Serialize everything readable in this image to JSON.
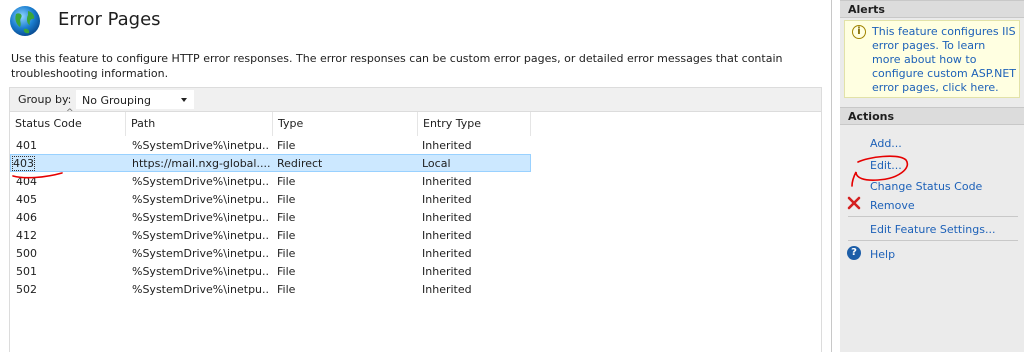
{
  "header": {
    "title": "Error Pages",
    "description": "Use this feature to configure HTTP error responses. The error responses can be custom error pages, or detailed error messages that contain troubleshooting information."
  },
  "toolbar": {
    "group_by_label": "Group by:",
    "group_by_value": "No Grouping"
  },
  "grid": {
    "columns": [
      "Status Code",
      "Path",
      "Type",
      "Entry Type"
    ],
    "rows": [
      {
        "code": "401",
        "path": "%SystemDrive%\\inetpu...",
        "type": "File",
        "entry": "Inherited"
      },
      {
        "code": "403",
        "path": "https://mail.nxg-global....",
        "type": "Redirect",
        "entry": "Local"
      },
      {
        "code": "404",
        "path": "%SystemDrive%\\inetpu...",
        "type": "File",
        "entry": "Inherited"
      },
      {
        "code": "405",
        "path": "%SystemDrive%\\inetpu...",
        "type": "File",
        "entry": "Inherited"
      },
      {
        "code": "406",
        "path": "%SystemDrive%\\inetpu...",
        "type": "File",
        "entry": "Inherited"
      },
      {
        "code": "412",
        "path": "%SystemDrive%\\inetpu...",
        "type": "File",
        "entry": "Inherited"
      },
      {
        "code": "500",
        "path": "%SystemDrive%\\inetpu...",
        "type": "File",
        "entry": "Inherited"
      },
      {
        "code": "501",
        "path": "%SystemDrive%\\inetpu...",
        "type": "File",
        "entry": "Inherited"
      },
      {
        "code": "502",
        "path": "%SystemDrive%\\inetpu...",
        "type": "File",
        "entry": "Inherited"
      }
    ],
    "selected_code": "403"
  },
  "alerts": {
    "header": "Alerts",
    "text": "This feature configures IIS error pages. To learn more about how to configure custom ASP.NET error pages, click here."
  },
  "actions": {
    "header": "Actions",
    "add": "Add...",
    "edit": "Edit...",
    "change_status_code": "Change Status Code",
    "remove": "Remove",
    "edit_feature_settings": "Edit Feature Settings...",
    "help": "Help"
  },
  "colors": {
    "link": "#1d61b8",
    "selection": "#cce8ff",
    "annotation": "#e60000",
    "pane_bg": "#ebebeb"
  }
}
